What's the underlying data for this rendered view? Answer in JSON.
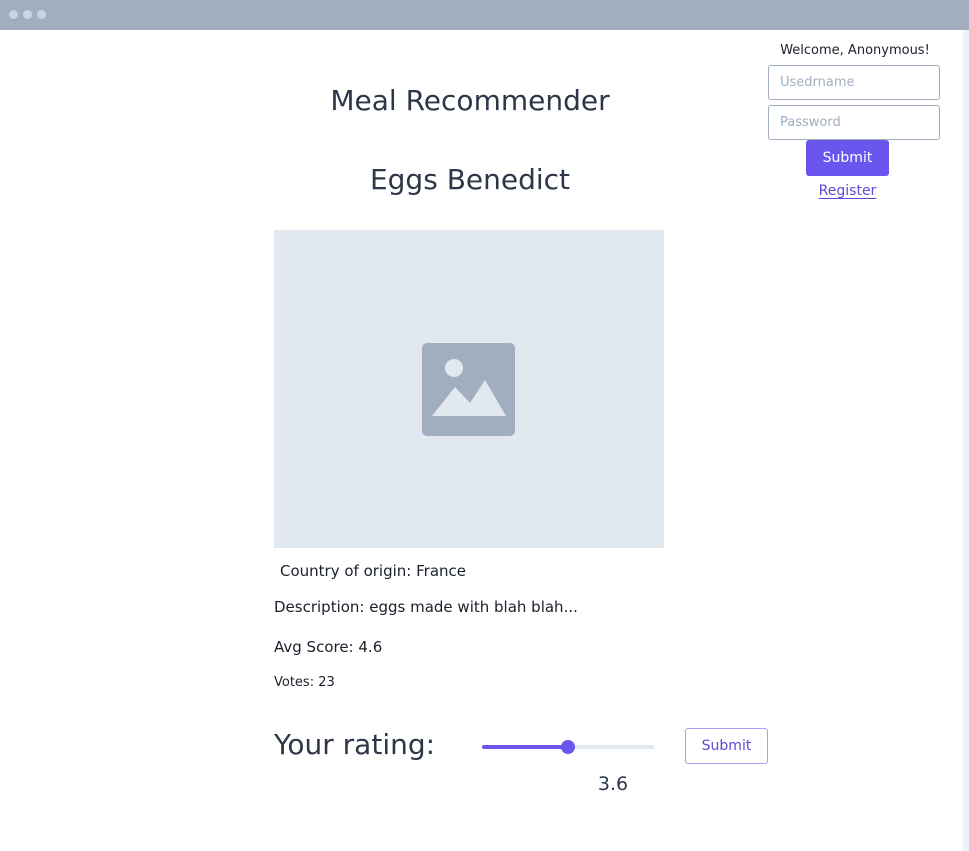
{
  "header": {
    "title": "Meal Recommender"
  },
  "auth": {
    "welcome": "Welcome, Anonymous!",
    "username_placeholder": "Usedrname",
    "password_placeholder": "Password",
    "submit_label": "Submit",
    "register_label": "Register"
  },
  "meal": {
    "name": "Eggs Benedict",
    "image_icon": "image-placeholder-icon",
    "country": "Country of origin: France",
    "description": "Description: eggs made with blah blah...",
    "avg_score": "Avg Score: 4.6",
    "votes": "Votes: 23"
  },
  "rating": {
    "label": "Your rating:",
    "value": "3.6",
    "slider_fraction": 0.5,
    "submit_label": "Submit"
  },
  "colors": {
    "accent": "#6a56ee",
    "titlebar": "#a0aec0",
    "image_bg": "#e2e8f0",
    "icon": "#a0aec0"
  }
}
